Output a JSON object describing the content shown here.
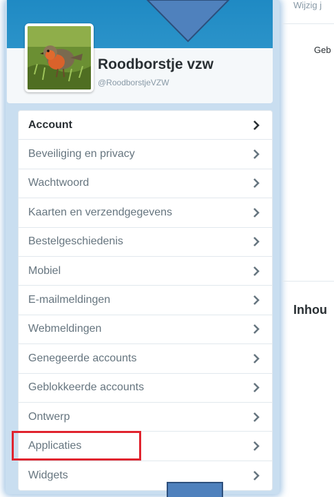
{
  "profile": {
    "display_name": "Roodborstje vzw",
    "handle": "@RoodborstjeVZW"
  },
  "menu": {
    "items": [
      {
        "label": "Account",
        "active": true
      },
      {
        "label": "Beveiliging en privacy",
        "active": false
      },
      {
        "label": "Wachtwoord",
        "active": false
      },
      {
        "label": "Kaarten en verzendgegevens",
        "active": false
      },
      {
        "label": "Bestelgeschiedenis",
        "active": false
      },
      {
        "label": "Mobiel",
        "active": false
      },
      {
        "label": "E-mailmeldingen",
        "active": false
      },
      {
        "label": "Webmeldingen",
        "active": false
      },
      {
        "label": "Genegeerde accounts",
        "active": false
      },
      {
        "label": "Geblokkeerde accounts",
        "active": false
      },
      {
        "label": "Ontwerp",
        "active": false
      },
      {
        "label": "Applicaties",
        "active": false
      },
      {
        "label": "Widgets",
        "active": false
      }
    ],
    "chevron_icon": "chevron-right-icon"
  },
  "right_panel": {
    "top_text": "Wijzig j",
    "field_label": "Geb",
    "section_heading": "Inhou"
  },
  "annotations": {
    "highlight_color": "#e0232e",
    "arrow_color": "#4f81bd",
    "highlighted_item": "Applicaties"
  },
  "colors": {
    "header_blue": "#2b93c9",
    "sidebar_glow": "#c9def0"
  }
}
